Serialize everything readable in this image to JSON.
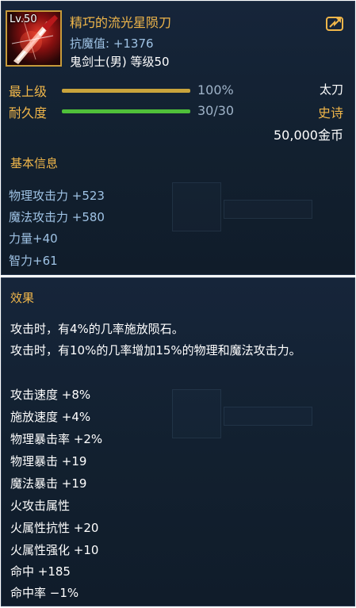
{
  "item": {
    "level_badge": "Lv.50",
    "name": "精巧的流光星陨刀",
    "anti_magic": "抗魔值: +1376",
    "job_level": "鬼剑士(男) 等级50",
    "icon": "glowing-blade-icon",
    "share_icon": "share-icon"
  },
  "grade": {
    "label": "最上级",
    "value": "100%",
    "fraction": 1.0,
    "color": "#c9a43c"
  },
  "durability": {
    "label": "耐久度",
    "value": "30/30",
    "fraction": 1.0,
    "color": "#4fbf3a"
  },
  "weapon_type": "太刀",
  "rarity": "史诗",
  "price": "50,000金币",
  "basic_info": {
    "title": "基本信息",
    "lines": [
      "物理攻击力 +523",
      "魔法攻击力 +580",
      "力量+40",
      "智力+61"
    ]
  },
  "effects": {
    "title": "效果",
    "descriptions": [
      "攻击时，有4%的几率施放陨石。",
      "攻击时，有10%的几率增加15%的物理和魔法攻击力。"
    ],
    "stats": [
      "攻击速度 +8%",
      "施放速度 +4%",
      "物理暴击率 +2%",
      "物理暴击 +19",
      "魔法暴击 +19",
      "火攻击属性",
      "火属性抗性 +20",
      "火属性强化 +10",
      "命中 +185",
      "命中率 −1%"
    ]
  }
}
